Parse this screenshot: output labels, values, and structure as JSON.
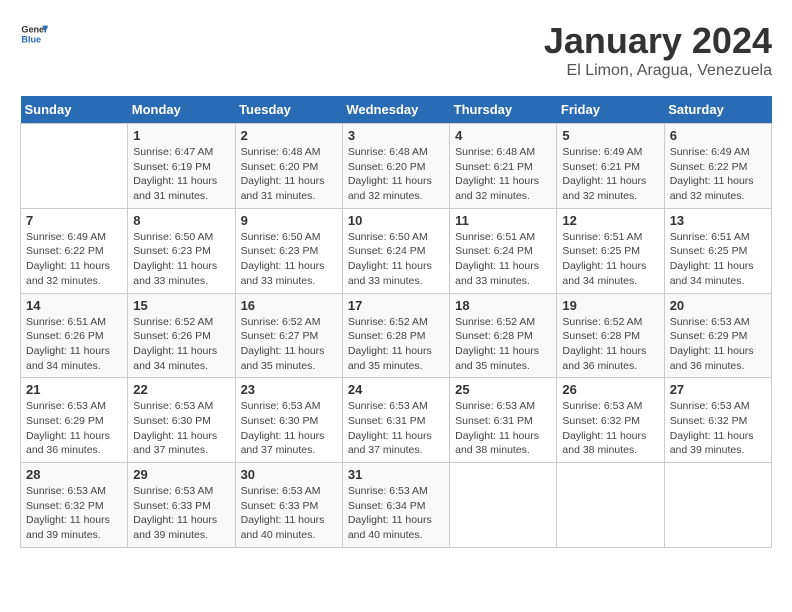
{
  "header": {
    "logo_general": "General",
    "logo_blue": "Blue",
    "title": "January 2024",
    "subtitle": "El Limon, Aragua, Venezuela"
  },
  "days_of_week": [
    "Sunday",
    "Monday",
    "Tuesday",
    "Wednesday",
    "Thursday",
    "Friday",
    "Saturday"
  ],
  "weeks": [
    [
      {
        "day": "",
        "detail": ""
      },
      {
        "day": "1",
        "detail": "Sunrise: 6:47 AM\nSunset: 6:19 PM\nDaylight: 11 hours\nand 31 minutes."
      },
      {
        "day": "2",
        "detail": "Sunrise: 6:48 AM\nSunset: 6:20 PM\nDaylight: 11 hours\nand 31 minutes."
      },
      {
        "day": "3",
        "detail": "Sunrise: 6:48 AM\nSunset: 6:20 PM\nDaylight: 11 hours\nand 32 minutes."
      },
      {
        "day": "4",
        "detail": "Sunrise: 6:48 AM\nSunset: 6:21 PM\nDaylight: 11 hours\nand 32 minutes."
      },
      {
        "day": "5",
        "detail": "Sunrise: 6:49 AM\nSunset: 6:21 PM\nDaylight: 11 hours\nand 32 minutes."
      },
      {
        "day": "6",
        "detail": "Sunrise: 6:49 AM\nSunset: 6:22 PM\nDaylight: 11 hours\nand 32 minutes."
      }
    ],
    [
      {
        "day": "7",
        "detail": "Sunrise: 6:49 AM\nSunset: 6:22 PM\nDaylight: 11 hours\nand 32 minutes."
      },
      {
        "day": "8",
        "detail": "Sunrise: 6:50 AM\nSunset: 6:23 PM\nDaylight: 11 hours\nand 33 minutes."
      },
      {
        "day": "9",
        "detail": "Sunrise: 6:50 AM\nSunset: 6:23 PM\nDaylight: 11 hours\nand 33 minutes."
      },
      {
        "day": "10",
        "detail": "Sunrise: 6:50 AM\nSunset: 6:24 PM\nDaylight: 11 hours\nand 33 minutes."
      },
      {
        "day": "11",
        "detail": "Sunrise: 6:51 AM\nSunset: 6:24 PM\nDaylight: 11 hours\nand 33 minutes."
      },
      {
        "day": "12",
        "detail": "Sunrise: 6:51 AM\nSunset: 6:25 PM\nDaylight: 11 hours\nand 34 minutes."
      },
      {
        "day": "13",
        "detail": "Sunrise: 6:51 AM\nSunset: 6:25 PM\nDaylight: 11 hours\nand 34 minutes."
      }
    ],
    [
      {
        "day": "14",
        "detail": "Sunrise: 6:51 AM\nSunset: 6:26 PM\nDaylight: 11 hours\nand 34 minutes."
      },
      {
        "day": "15",
        "detail": "Sunrise: 6:52 AM\nSunset: 6:26 PM\nDaylight: 11 hours\nand 34 minutes."
      },
      {
        "day": "16",
        "detail": "Sunrise: 6:52 AM\nSunset: 6:27 PM\nDaylight: 11 hours\nand 35 minutes."
      },
      {
        "day": "17",
        "detail": "Sunrise: 6:52 AM\nSunset: 6:28 PM\nDaylight: 11 hours\nand 35 minutes."
      },
      {
        "day": "18",
        "detail": "Sunrise: 6:52 AM\nSunset: 6:28 PM\nDaylight: 11 hours\nand 35 minutes."
      },
      {
        "day": "19",
        "detail": "Sunrise: 6:52 AM\nSunset: 6:28 PM\nDaylight: 11 hours\nand 36 minutes."
      },
      {
        "day": "20",
        "detail": "Sunrise: 6:53 AM\nSunset: 6:29 PM\nDaylight: 11 hours\nand 36 minutes."
      }
    ],
    [
      {
        "day": "21",
        "detail": "Sunrise: 6:53 AM\nSunset: 6:29 PM\nDaylight: 11 hours\nand 36 minutes."
      },
      {
        "day": "22",
        "detail": "Sunrise: 6:53 AM\nSunset: 6:30 PM\nDaylight: 11 hours\nand 37 minutes."
      },
      {
        "day": "23",
        "detail": "Sunrise: 6:53 AM\nSunset: 6:30 PM\nDaylight: 11 hours\nand 37 minutes."
      },
      {
        "day": "24",
        "detail": "Sunrise: 6:53 AM\nSunset: 6:31 PM\nDaylight: 11 hours\nand 37 minutes."
      },
      {
        "day": "25",
        "detail": "Sunrise: 6:53 AM\nSunset: 6:31 PM\nDaylight: 11 hours\nand 38 minutes."
      },
      {
        "day": "26",
        "detail": "Sunrise: 6:53 AM\nSunset: 6:32 PM\nDaylight: 11 hours\nand 38 minutes."
      },
      {
        "day": "27",
        "detail": "Sunrise: 6:53 AM\nSunset: 6:32 PM\nDaylight: 11 hours\nand 39 minutes."
      }
    ],
    [
      {
        "day": "28",
        "detail": "Sunrise: 6:53 AM\nSunset: 6:32 PM\nDaylight: 11 hours\nand 39 minutes."
      },
      {
        "day": "29",
        "detail": "Sunrise: 6:53 AM\nSunset: 6:33 PM\nDaylight: 11 hours\nand 39 minutes."
      },
      {
        "day": "30",
        "detail": "Sunrise: 6:53 AM\nSunset: 6:33 PM\nDaylight: 11 hours\nand 40 minutes."
      },
      {
        "day": "31",
        "detail": "Sunrise: 6:53 AM\nSunset: 6:34 PM\nDaylight: 11 hours\nand 40 minutes."
      },
      {
        "day": "",
        "detail": ""
      },
      {
        "day": "",
        "detail": ""
      },
      {
        "day": "",
        "detail": ""
      }
    ]
  ]
}
